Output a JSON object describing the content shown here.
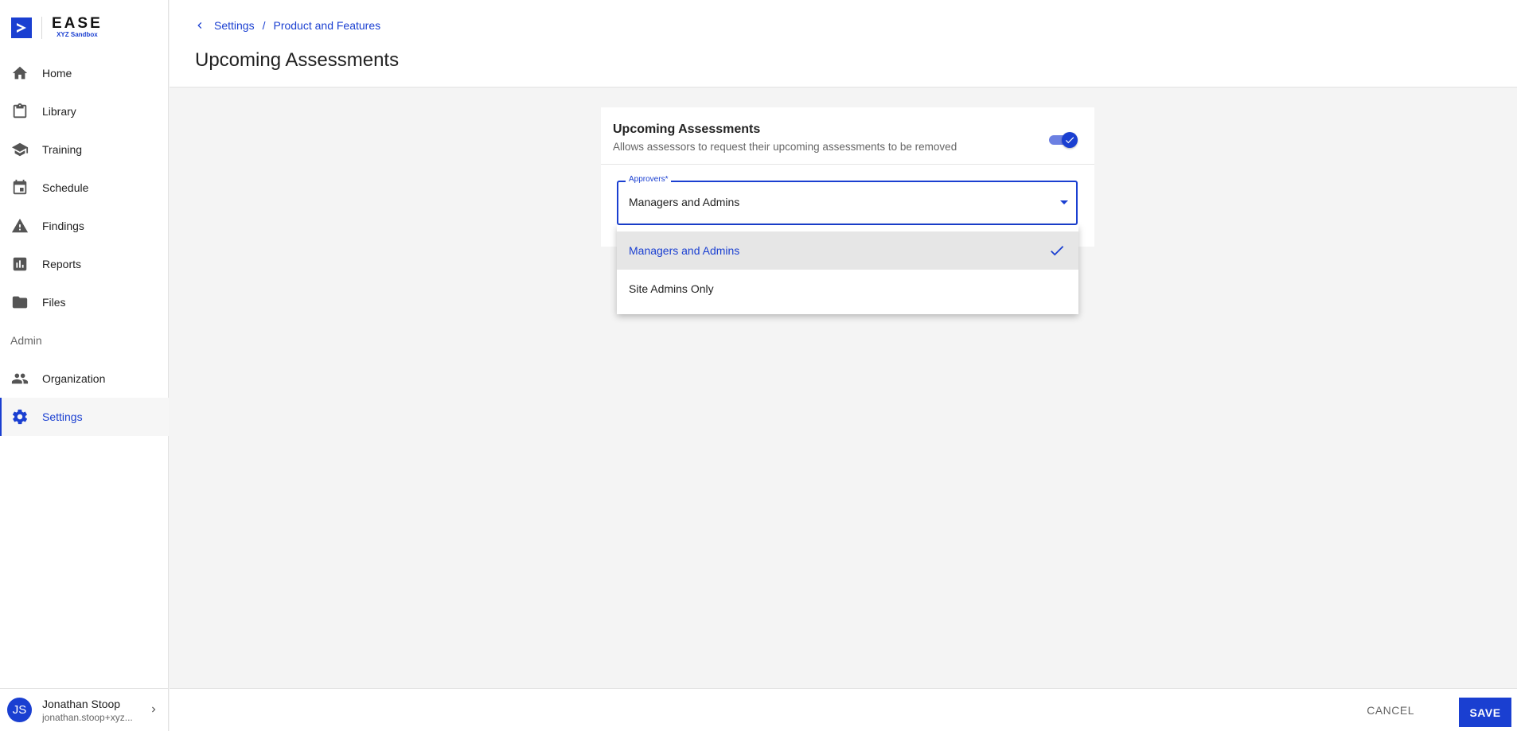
{
  "app": {
    "logo_name": "EASE",
    "logo_sub": "XYZ Sandbox",
    "brand_color": "#1a3fd1"
  },
  "sidebar": {
    "items": [
      {
        "label": "Home",
        "icon": "home-icon"
      },
      {
        "label": "Library",
        "icon": "clipboard-icon"
      },
      {
        "label": "Training",
        "icon": "graduation-cap-icon"
      },
      {
        "label": "Schedule",
        "icon": "calendar-icon"
      },
      {
        "label": "Findings",
        "icon": "warning-icon"
      },
      {
        "label": "Reports",
        "icon": "bar-chart-icon"
      },
      {
        "label": "Files",
        "icon": "folder-icon"
      }
    ],
    "section_label": "Admin",
    "admin_items": [
      {
        "label": "Organization",
        "icon": "people-icon"
      },
      {
        "label": "Settings",
        "icon": "gear-icon",
        "active": true
      }
    ],
    "user": {
      "initials": "JS",
      "name": "Jonathan Stoop",
      "email": "jonathan.stoop+xyz..."
    }
  },
  "header": {
    "breadcrumb": [
      "Settings",
      "Product and Features"
    ],
    "breadcrumb_sep": "/",
    "title": "Upcoming Assessments"
  },
  "card": {
    "title": "Upcoming Assessments",
    "description": "Allows assessors to request their upcoming assessments to be removed",
    "toggle_on": true,
    "select": {
      "label": "Approvers*",
      "value": "Managers and Admins"
    }
  },
  "dropdown": {
    "options": [
      {
        "label": "Managers and Admins",
        "selected": true
      },
      {
        "label": "Site Admins Only",
        "selected": false
      }
    ]
  },
  "footer": {
    "cancel_label": "CANCEL",
    "save_label": "SAVE"
  }
}
